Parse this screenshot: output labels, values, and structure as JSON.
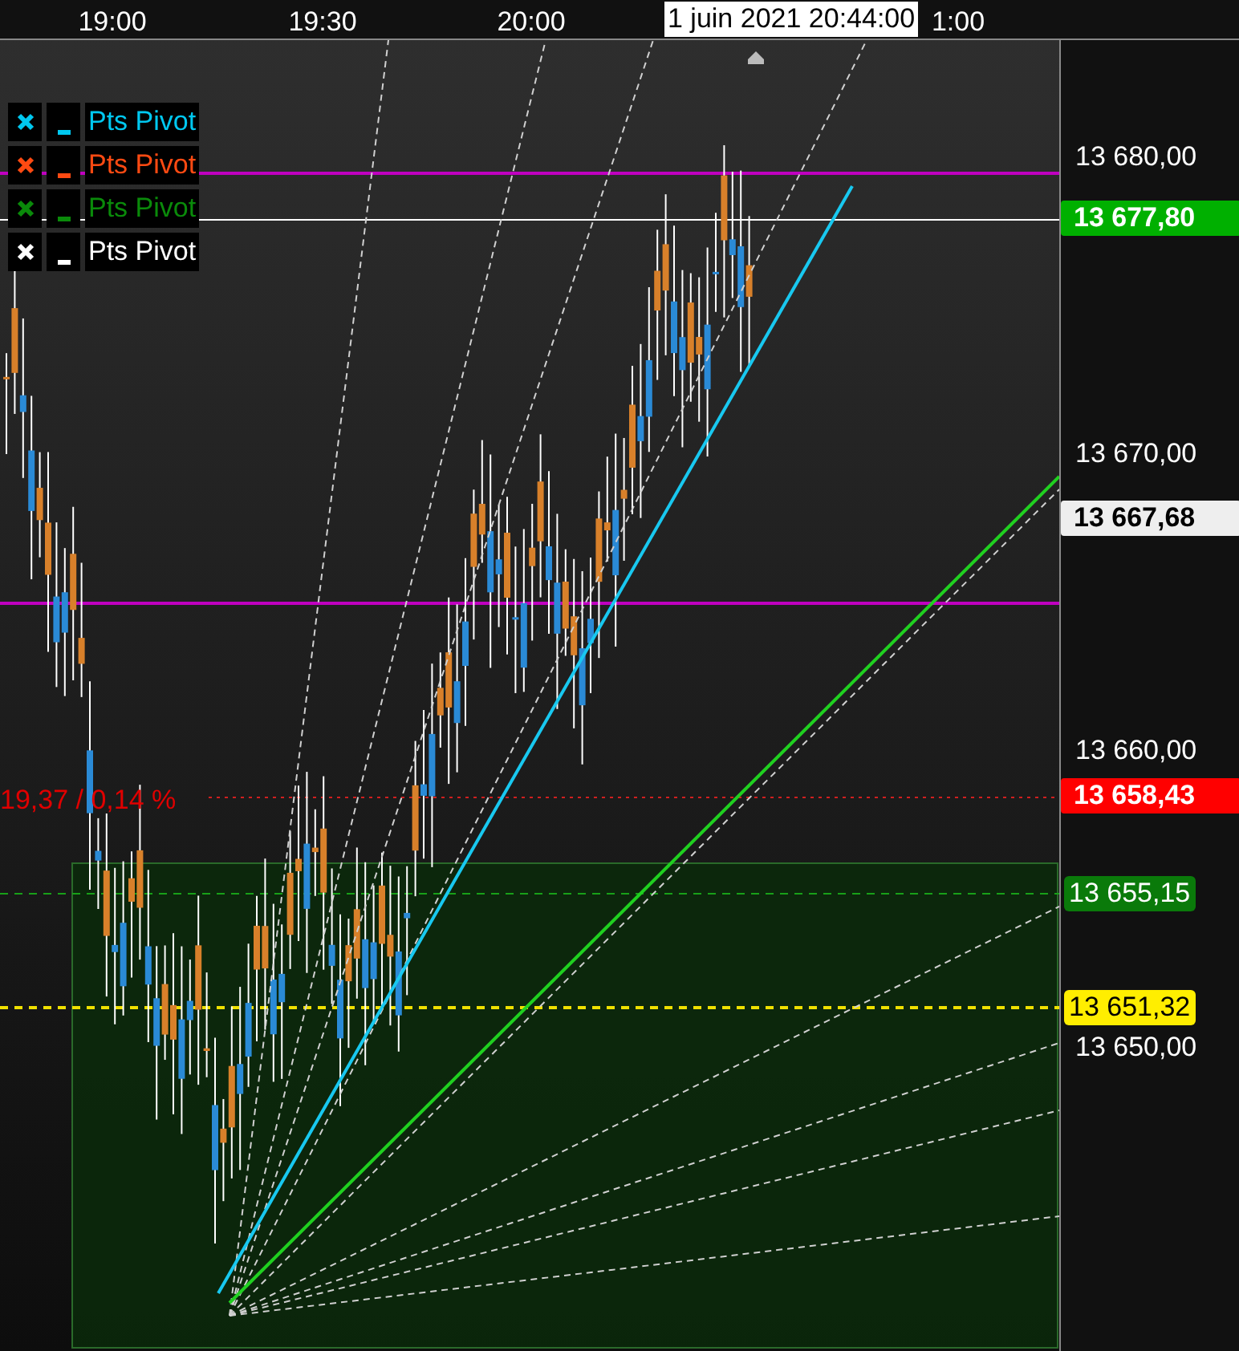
{
  "time_axis": {
    "ticks": [
      "19:00",
      "19:30",
      "20:00",
      "1:00"
    ],
    "crosshair_label": "1 juin 2021 20:44:00"
  },
  "legend": [
    {
      "label": "Pts Pivot",
      "color": "#00c8f0"
    },
    {
      "label": "Pts Pivot",
      "color": "#ff4a12"
    },
    {
      "label": "Pts Pivot",
      "color": "#0a8a0a"
    },
    {
      "label": "Pts Pivot",
      "color": "#ffffff"
    }
  ],
  "measure_label": "19,37 / 0,14 %",
  "price_axis": {
    "ticks": [
      "13 680,00",
      "13 670,00",
      "13 660,00",
      "13 650,00"
    ],
    "markers": [
      {
        "label": "13 677,80",
        "kind": "price",
        "color": "#00b000"
      },
      {
        "label": "13 667,68",
        "kind": "price",
        "color": "#eeeeee"
      },
      {
        "label": "13 658,43",
        "kind": "price",
        "color": "#ff0000"
      },
      {
        "label": "13 655,15",
        "kind": "level",
        "color": "#0a7a0a"
      },
      {
        "label": "13 651,32",
        "kind": "level",
        "color": "#ffee00"
      }
    ]
  }
}
